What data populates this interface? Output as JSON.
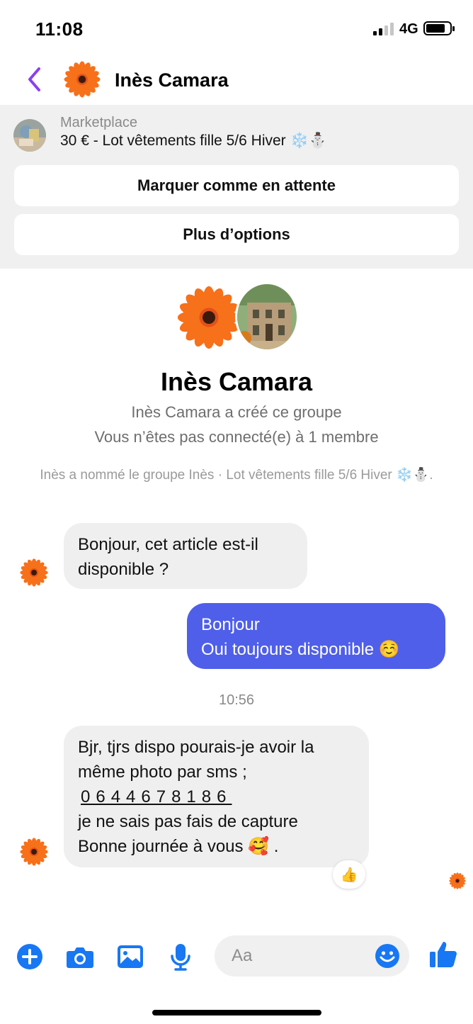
{
  "status_bar": {
    "time": "11:08",
    "network": "4G",
    "icons": [
      "signal-icon",
      "battery-icon"
    ]
  },
  "header": {
    "contact_name": "Inès Camara",
    "icons": [
      "back-chevron-icon",
      "flower-avatar"
    ]
  },
  "marketplace": {
    "label": "Marketplace",
    "listing_title": "30 € - Lot vêtements fille 5/6 Hiver ❄️⛄",
    "hold_button": "Marquer comme en attente",
    "more_button": "Plus d’options"
  },
  "group": {
    "name": "Inès Camara",
    "created_by": "Inès Camara a créé ce groupe",
    "connection": "Vous n’êtes pas connecté(e) à 1 membre",
    "notice": "Inès a nommé le groupe Inès · Lot vêtements fille 5/6 Hiver ❄️⛄."
  },
  "messages": [
    {
      "direction": "received",
      "lines": [
        "Bonjour, cet article est-il",
        "disponible ?"
      ]
    },
    {
      "direction": "sent",
      "lines": [
        "Bonjour",
        "Oui toujours disponible ☺️"
      ]
    },
    {
      "direction": "received",
      "lines": [
        "Bjr, tjrs dispo pourais-je avoir la",
        "même photo par sms ;",
        "0644678186",
        "je ne sais pas fais de capture",
        "Bonne journée à vous 🥰 ."
      ],
      "reaction": "👍"
    }
  ],
  "timestamp": "10:56",
  "composer": {
    "placeholder": "Aa",
    "icons": [
      "plus-icon",
      "camera-icon",
      "image-icon",
      "microphone-icon",
      "emoji-icon",
      "thumbs-up-icon"
    ]
  },
  "colors": {
    "accent": "#4f5fe9",
    "messenger_blue": "#1877f2",
    "back_chevron": "#8b3ff0",
    "bubble_received": "#efefef"
  }
}
